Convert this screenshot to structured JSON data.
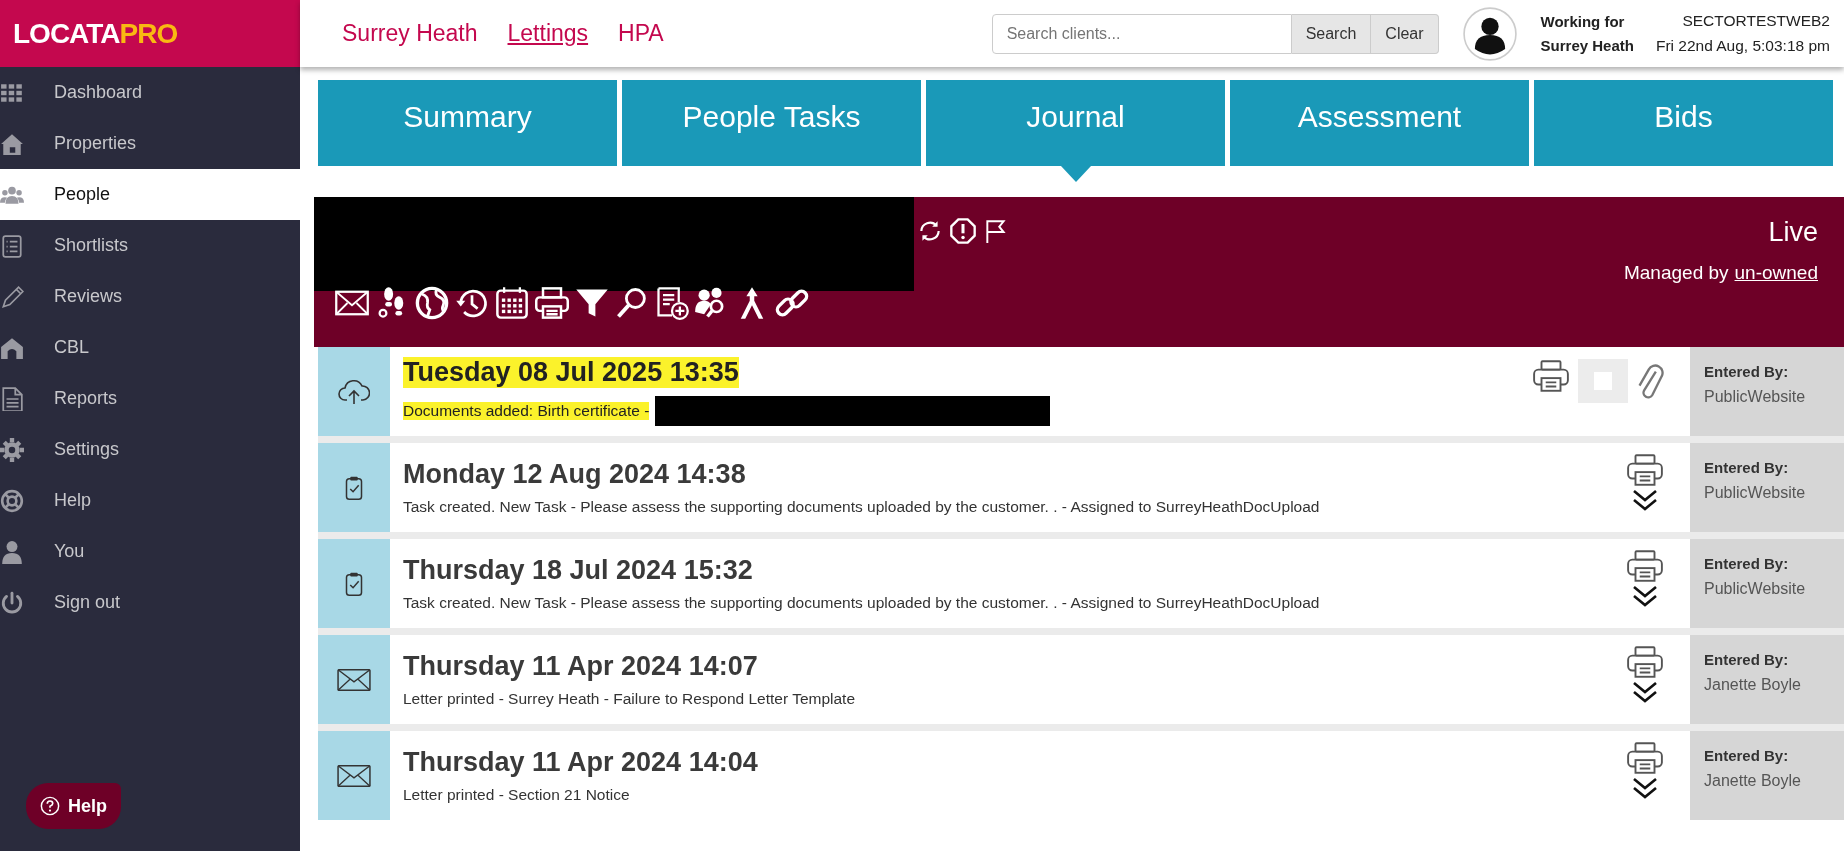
{
  "logo": [
    "LOCATA",
    "PRO"
  ],
  "sidebar": {
    "items": [
      {
        "label": "Dashboard",
        "selected": false
      },
      {
        "label": "Properties",
        "selected": false
      },
      {
        "label": "People",
        "selected": true
      },
      {
        "label": "Shortlists",
        "selected": false
      },
      {
        "label": "Reviews",
        "selected": false
      },
      {
        "label": "CBL",
        "selected": false
      },
      {
        "label": "Reports",
        "selected": false
      },
      {
        "label": "Settings",
        "selected": false
      },
      {
        "label": "Help",
        "selected": false
      },
      {
        "label": "You",
        "selected": false
      },
      {
        "label": "Sign out",
        "selected": false
      }
    ],
    "help_button": "Help"
  },
  "header": {
    "links": [
      {
        "label": "Surrey Heath",
        "selected": false
      },
      {
        "label": "Lettings",
        "selected": true
      },
      {
        "label": "HPA",
        "selected": false
      }
    ],
    "search": {
      "placeholder": "Search clients..."
    },
    "buttons": [
      "Search",
      "Clear"
    ],
    "working_for": [
      "Working for",
      "Surrey Heath"
    ],
    "user": "SECTORTESTWEB2",
    "datetime": "Fri 22nd Aug, 5:03:18 pm"
  },
  "tabs": [
    {
      "label": "Summary",
      "selected": false
    },
    {
      "label": "People Tasks",
      "selected": false
    },
    {
      "label": "Journal",
      "selected": true
    },
    {
      "label": "Assessment",
      "selected": false
    },
    {
      "label": "Bids",
      "selected": false
    }
  ],
  "record": {
    "status": "Live",
    "managed_by_label": "Managed by",
    "managed_by": "un-owned"
  },
  "journal": [
    {
      "kind": "upload",
      "highlighted": true,
      "date": "Tuesday 08 Jul 2025 13:35",
      "text": "Documents added: Birth certificate -",
      "entered_by_label": "Entered By:",
      "entered_by": "PublicWebsite"
    },
    {
      "kind": "task",
      "highlighted": false,
      "date": "Monday 12 Aug 2024 14:38",
      "text": "Task created. New Task - Please assess the supporting documents uploaded by the customer. . - Assigned to SurreyHeathDocUpload",
      "entered_by_label": "Entered By:",
      "entered_by": "PublicWebsite"
    },
    {
      "kind": "task",
      "highlighted": false,
      "date": "Thursday 18 Jul 2024 15:32",
      "text": "Task created. New Task - Please assess the supporting documents uploaded by the customer. . - Assigned to SurreyHeathDocUpload",
      "entered_by_label": "Entered By:",
      "entered_by": "PublicWebsite"
    },
    {
      "kind": "letter",
      "highlighted": false,
      "date": "Thursday 11 Apr 2024 14:07",
      "text": "Letter printed - Surrey Heath - Failure to Respond Letter Template",
      "entered_by_label": "Entered By:",
      "entered_by": "Janette Boyle"
    },
    {
      "kind": "letter",
      "highlighted": false,
      "date": "Thursday 11 Apr 2024 14:04",
      "text": "Letter printed - Section 21 Notice",
      "entered_by_label": "Entered By:",
      "entered_by": "Janette Boyle"
    }
  ]
}
